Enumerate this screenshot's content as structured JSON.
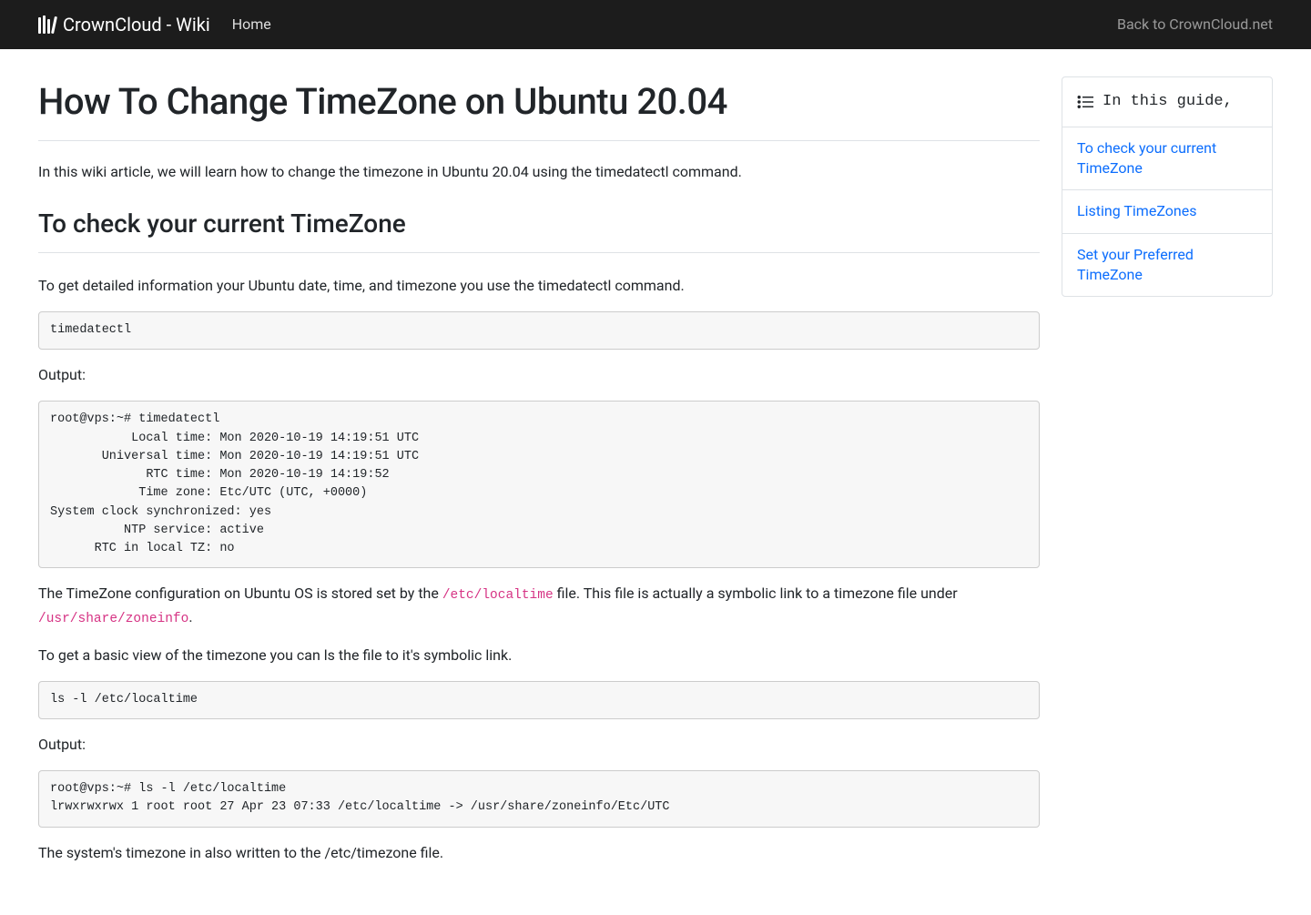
{
  "nav": {
    "brand": "CrownCloud - Wiki",
    "home": "Home",
    "back": "Back to CrownCloud.net"
  },
  "article": {
    "title": "How To Change TimeZone on Ubuntu 20.04",
    "intro": "In this wiki article, we will learn how to change the timezone in Ubuntu 20.04 using the timedatectl command.",
    "h2_1": "To check your current TimeZone",
    "p1": "To get detailed information your Ubuntu date, time, and timezone you use the timedatectl command.",
    "code1": "timedatectl",
    "output_label": "Output:",
    "code2": "root@vps:~# timedatectl\n           Local time: Mon 2020-10-19 14:19:51 UTC\n       Universal time: Mon 2020-10-19 14:19:51 UTC\n             RTC time: Mon 2020-10-19 14:19:52\n            Time zone: Etc/UTC (UTC, +0000)\nSystem clock synchronized: yes\n          NTP service: active\n      RTC in local TZ: no",
    "p2_a": "The TimeZone configuration on Ubuntu OS is stored set by the ",
    "p2_code1": "/etc/localtime",
    "p2_b": " file. This file is actually a symbolic link to a timezone file under ",
    "p2_code2": "/usr/share/zoneinfo",
    "p2_c": ".",
    "p3": "To get a basic view of the timezone you can ls the file to it's symbolic link.",
    "code3": "ls -l /etc/localtime",
    "code4": "root@vps:~# ls -l /etc/localtime\nlrwxrwxrwx 1 root root 27 Apr 23 07:33 /etc/localtime -> /usr/share/zoneinfo/Etc/UTC",
    "p4": "The system's timezone in also written to the /etc/timezone file."
  },
  "toc": {
    "title": "In this guide,",
    "items": [
      "To check your current TimeZone",
      "Listing TimeZones",
      "Set your Preferred TimeZone"
    ]
  }
}
